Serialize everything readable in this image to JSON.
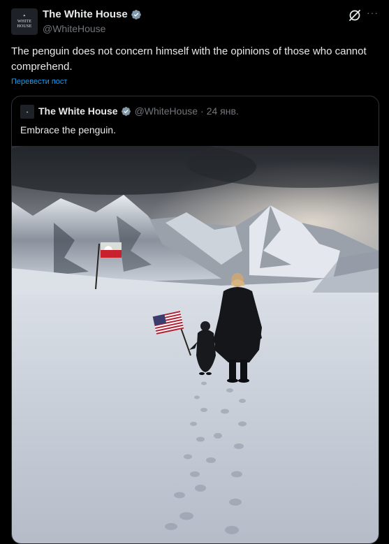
{
  "post": {
    "author_name": "The White House",
    "handle": "@WhiteHouse",
    "avatar_text": "WHITE HOUSE",
    "text": "The penguin does not concern himself with the opinions of those who cannot comprehend.",
    "translate_label": "Перевести пост",
    "more_label": "···"
  },
  "quote": {
    "author_name": "The White House",
    "handle": "@WhiteHouse",
    "separator": "·",
    "date": "24 янв.",
    "text": "Embrace the penguin."
  },
  "colors": {
    "background": "#000000",
    "text": "#e7e9ea",
    "muted": "#71767b",
    "link": "#1d9bf0",
    "verified": "#829aab",
    "border": "#2f3336"
  },
  "icons": {
    "verified": "verified-badge-icon",
    "grok": "grok-icon",
    "more": "more-icon"
  }
}
